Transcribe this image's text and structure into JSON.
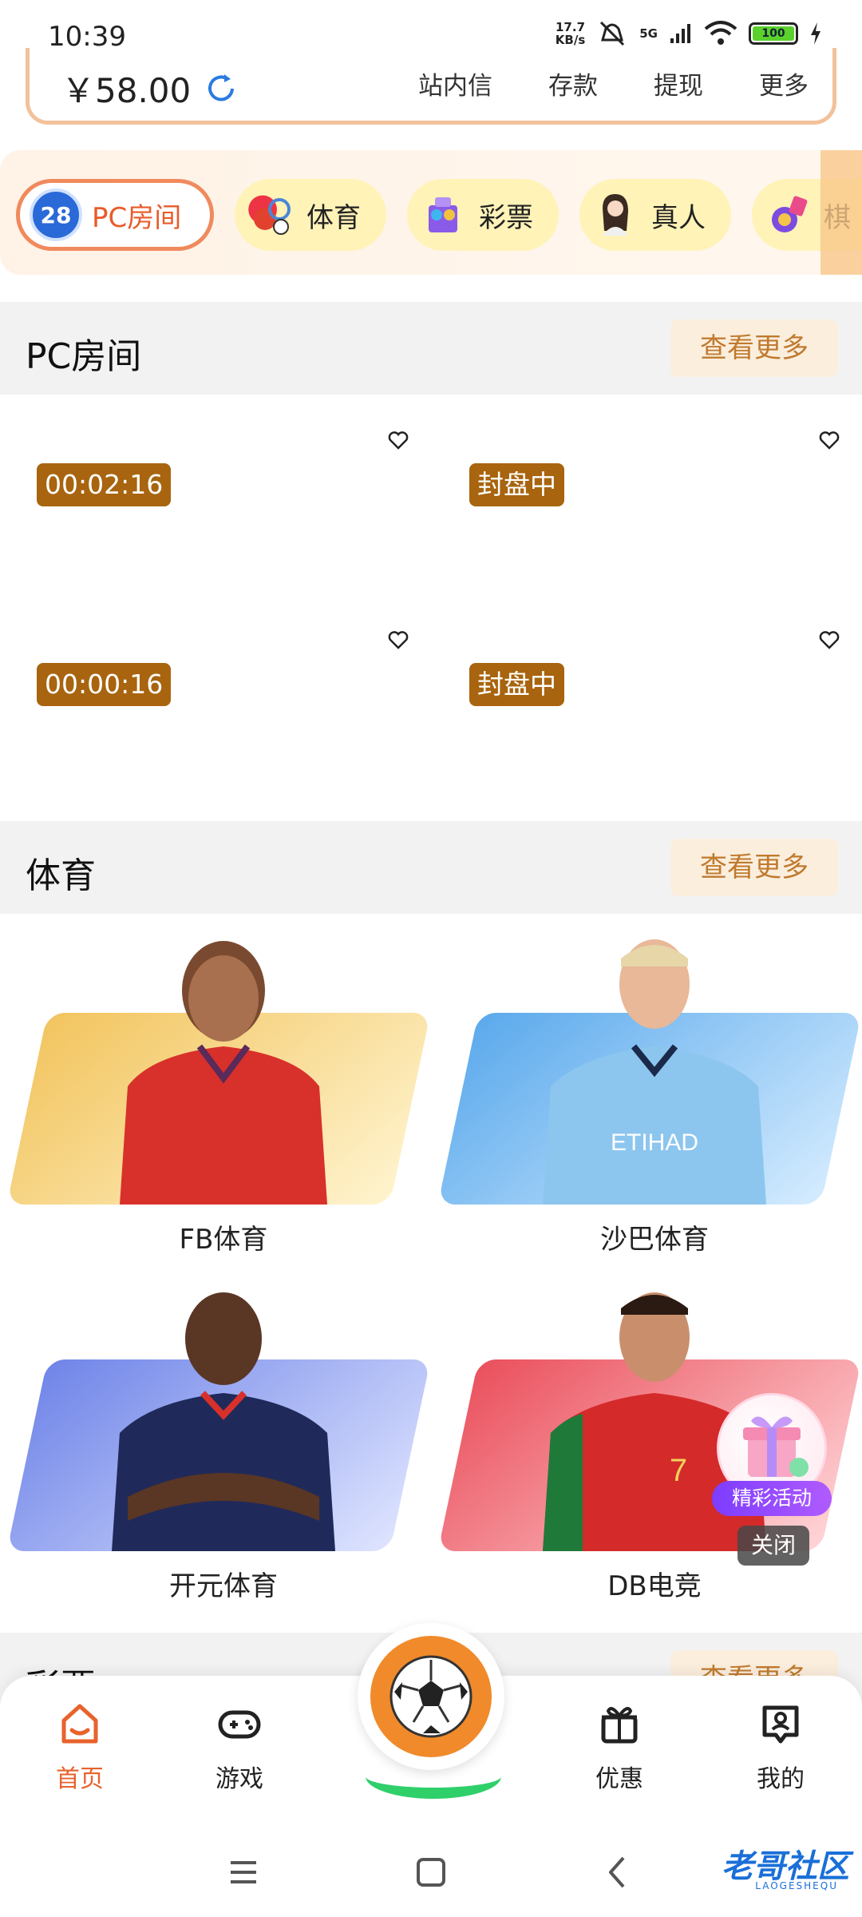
{
  "status_bar": {
    "time": "10:39",
    "net_speed_top": "17.7",
    "net_speed_bottom": "KB/s",
    "signal": "5G",
    "battery": "100"
  },
  "wallet": {
    "balance": "￥58.00",
    "links": [
      "站内信",
      "存款",
      "提现",
      "更多"
    ]
  },
  "categories": [
    {
      "label": "PC房间",
      "badge": "28",
      "active": true
    },
    {
      "label": "体育",
      "badge": "",
      "active": false
    },
    {
      "label": "彩票",
      "badge": "",
      "active": false
    },
    {
      "label": "真人",
      "badge": "",
      "active": false
    },
    {
      "label": "棋",
      "badge": "",
      "active": false
    }
  ],
  "pc_section": {
    "title": "PC房间",
    "more": "查看更多",
    "rooms": [
      {
        "status": "00:02:16"
      },
      {
        "status": "封盘中"
      },
      {
        "status": "00:00:16"
      },
      {
        "status": "封盘中"
      }
    ]
  },
  "sports_section": {
    "title": "体育",
    "more": "查看更多",
    "items": [
      {
        "label": "FB体育",
        "bg": "#f7d68a"
      },
      {
        "label": "沙巴体育",
        "bg": "#8cc8f2"
      },
      {
        "label": "开元体育",
        "bg": "#8f9ff0"
      },
      {
        "label": "DB电竞",
        "bg": "#f27c84"
      }
    ]
  },
  "lottery_section": {
    "title": "彩票",
    "more": "查看更多"
  },
  "promo": {
    "tag": "精彩活动",
    "close": "关闭"
  },
  "bottom_nav": {
    "items": [
      "首页",
      "游戏",
      "优惠",
      "我的"
    ]
  },
  "watermark": {
    "text": "老哥社区",
    "sub": "LAOGESHEQU"
  },
  "colors": {
    "accent": "#e8622c",
    "timer_bg": "#a8640e",
    "more_text": "#c07a2e"
  }
}
